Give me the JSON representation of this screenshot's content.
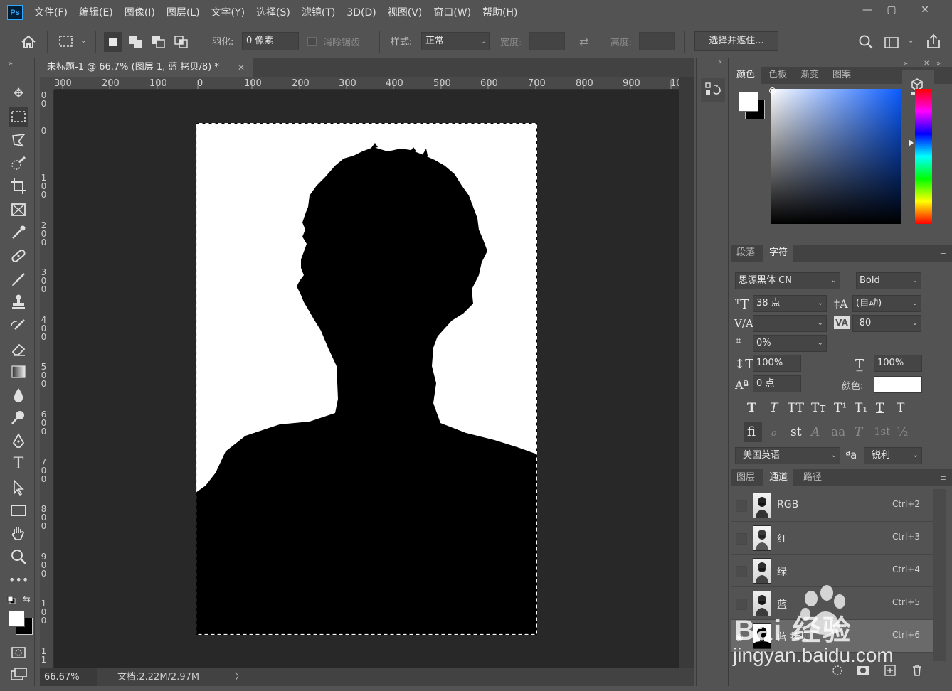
{
  "app": {
    "logo": "Ps"
  },
  "menu": [
    "文件(F)",
    "编辑(E)",
    "图像(I)",
    "图层(L)",
    "文字(Y)",
    "选择(S)",
    "滤镜(T)",
    "3D(D)",
    "视图(V)",
    "窗口(W)",
    "帮助(H)"
  ],
  "window_controls": [
    "—",
    "▢",
    "✕"
  ],
  "options": {
    "feather_label": "羽化:",
    "feather_value": "0 像素",
    "antialias_label": "消除锯齿",
    "style_label": "样式:",
    "style_value": "正常",
    "width_label": "宽度:",
    "height_label": "高度:",
    "select_mask_button": "选择并遮住..."
  },
  "document": {
    "tab_title": "未标题-1 @ 66.7% (图层 1, 蓝 拷贝/8) *",
    "ruler_h": [
      "300",
      "200",
      "100",
      "0",
      "100",
      "200",
      "300",
      "400",
      "500",
      "600",
      "700",
      "800",
      "900",
      "10"
    ],
    "ruler_v": [
      "00",
      "0",
      "100",
      "200",
      "300",
      "400",
      "500",
      "600",
      "700",
      "800",
      "900",
      "100",
      "11"
    ],
    "zoom": "66.67%",
    "doc_info": "文档:2.22M/2.97M",
    "status_arrow": "〉"
  },
  "color_panel": {
    "tabs": [
      "颜色",
      "色板",
      "渐变",
      "图案"
    ],
    "active_tab": "颜色",
    "foreground": "#ffffff",
    "background": "#000000"
  },
  "char_panel": {
    "tabs": [
      "段落",
      "字符"
    ],
    "active_tab": "字符",
    "font_family": "思源黑体 CN",
    "font_style": "Bold",
    "font_size": "38 点",
    "leading": "(自动)",
    "kerning": "",
    "tracking": "-80",
    "tsume": "0%",
    "vertical_scale": "100%",
    "horizontal_scale": "100%",
    "baseline_shift": "0 点",
    "color_label": "颜色:",
    "text_color": "#ffffff",
    "type_styles": [
      "T",
      "T",
      "TT",
      "Tт",
      "T¹",
      "T₁",
      "T",
      "Ŧ"
    ],
    "opentype": [
      "ﬁ",
      "ℴ",
      "st",
      "A",
      "aa",
      "T",
      "1st",
      "½"
    ],
    "language": "美国英语",
    "aa_label": "ªa",
    "antialias": "锐利"
  },
  "layers_panel": {
    "tabs": [
      "图层",
      "通道",
      "路径"
    ],
    "active_tab": "通道",
    "channels": [
      {
        "name": "RGB",
        "shortcut": "Ctrl+2"
      },
      {
        "name": "红",
        "shortcut": "Ctrl+3"
      },
      {
        "name": "绿",
        "shortcut": "Ctrl+4"
      },
      {
        "name": "蓝",
        "shortcut": "Ctrl+5"
      },
      {
        "name": "蓝 拷贝",
        "shortcut": "Ctrl+6"
      }
    ]
  },
  "watermark": {
    "text": "Bai 经验",
    "url": "jingyan.baidu.com"
  }
}
